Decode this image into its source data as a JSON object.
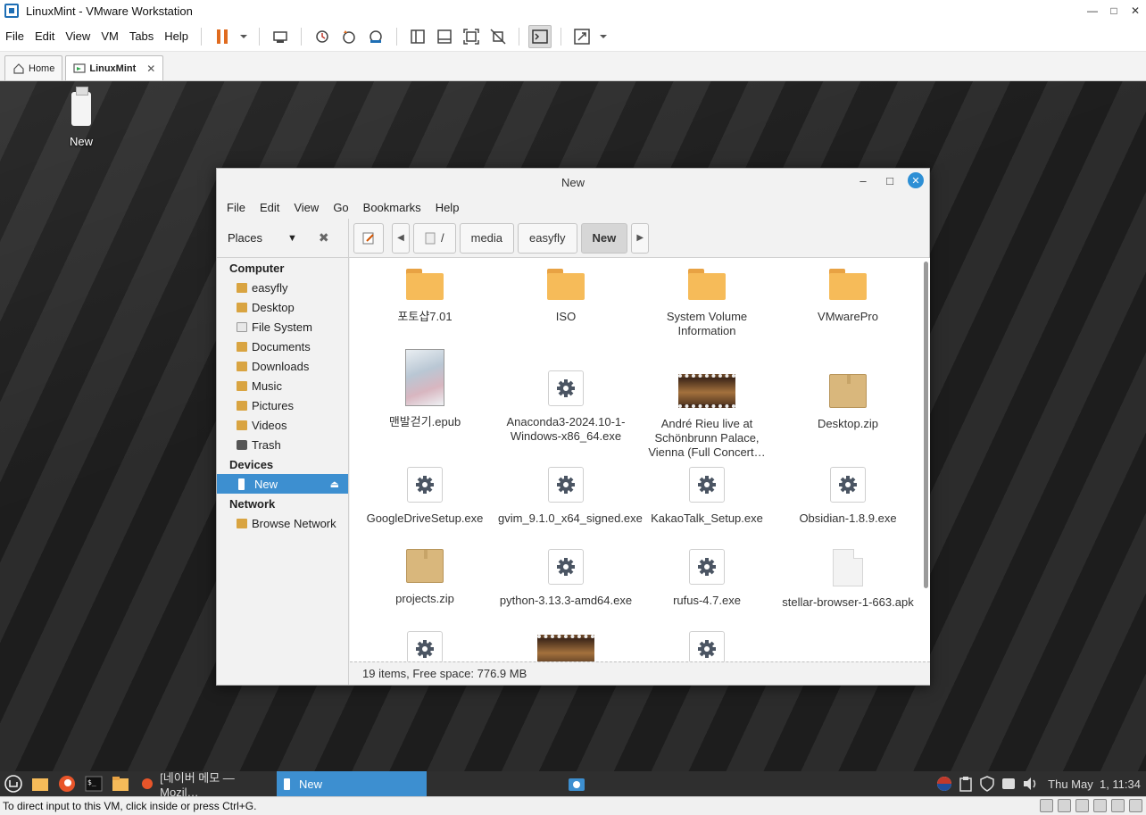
{
  "vmware": {
    "title": "LinuxMint - VMware Workstation",
    "menu": [
      "File",
      "Edit",
      "View",
      "VM",
      "Tabs",
      "Help"
    ],
    "tabs": [
      {
        "label": "Home"
      },
      {
        "label": "LinuxMint"
      }
    ],
    "status_text": "To direct input to this VM, click inside or press Ctrl+G."
  },
  "desktop": {
    "icon_label": "New"
  },
  "nemo": {
    "title": "New",
    "menu": [
      "File",
      "Edit",
      "View",
      "Go",
      "Bookmarks",
      "Help"
    ],
    "places_label": "Places",
    "path": [
      "/",
      "media",
      "easyfly",
      "New"
    ],
    "sidebar": {
      "computer_header": "Computer",
      "computer_items": [
        "easyfly",
        "Desktop",
        "File System",
        "Documents",
        "Downloads",
        "Music",
        "Pictures",
        "Videos",
        "Trash"
      ],
      "devices_header": "Devices",
      "device_item": "New",
      "network_header": "Network",
      "network_item": "Browse Network"
    },
    "files": [
      {
        "name": "포토샵7.01",
        "type": "folder"
      },
      {
        "name": "ISO",
        "type": "folder"
      },
      {
        "name": "System Volume Information",
        "type": "folder"
      },
      {
        "name": "VMwarePro",
        "type": "folder"
      },
      {
        "name": "맨발걷기.epub",
        "type": "book"
      },
      {
        "name": "Anaconda3-2024.10-1-Windows-x86_64.exe",
        "type": "exe"
      },
      {
        "name": "André Rieu live at Schönbrunn Palace, Vienna (Full Concert…",
        "type": "video"
      },
      {
        "name": "Desktop.zip",
        "type": "zip"
      },
      {
        "name": "GoogleDriveSetup.exe",
        "type": "exe"
      },
      {
        "name": "gvim_9.1.0_x64_signed.exe",
        "type": "exe"
      },
      {
        "name": "KakaoTalk_Setup.exe",
        "type": "exe"
      },
      {
        "name": "Obsidian-1.8.9.exe",
        "type": "exe"
      },
      {
        "name": "projects.zip",
        "type": "zip"
      },
      {
        "name": "python-3.13.3-amd64.exe",
        "type": "exe"
      },
      {
        "name": "rufus-4.7.exe",
        "type": "exe"
      },
      {
        "name": "stellar-browser-1-663.apk",
        "type": "doc"
      }
    ],
    "status": "19 items, Free space: 776.9 MB"
  },
  "panel": {
    "windows": [
      {
        "label": "[네이버 메모 — Mozil…"
      },
      {
        "label": "New"
      }
    ],
    "clock": "Thu May  1, 11:34"
  },
  "colors": {
    "selection": "#3d8fd0",
    "folder": "#f6bb59",
    "panel_bg": "#2f2f2f"
  }
}
